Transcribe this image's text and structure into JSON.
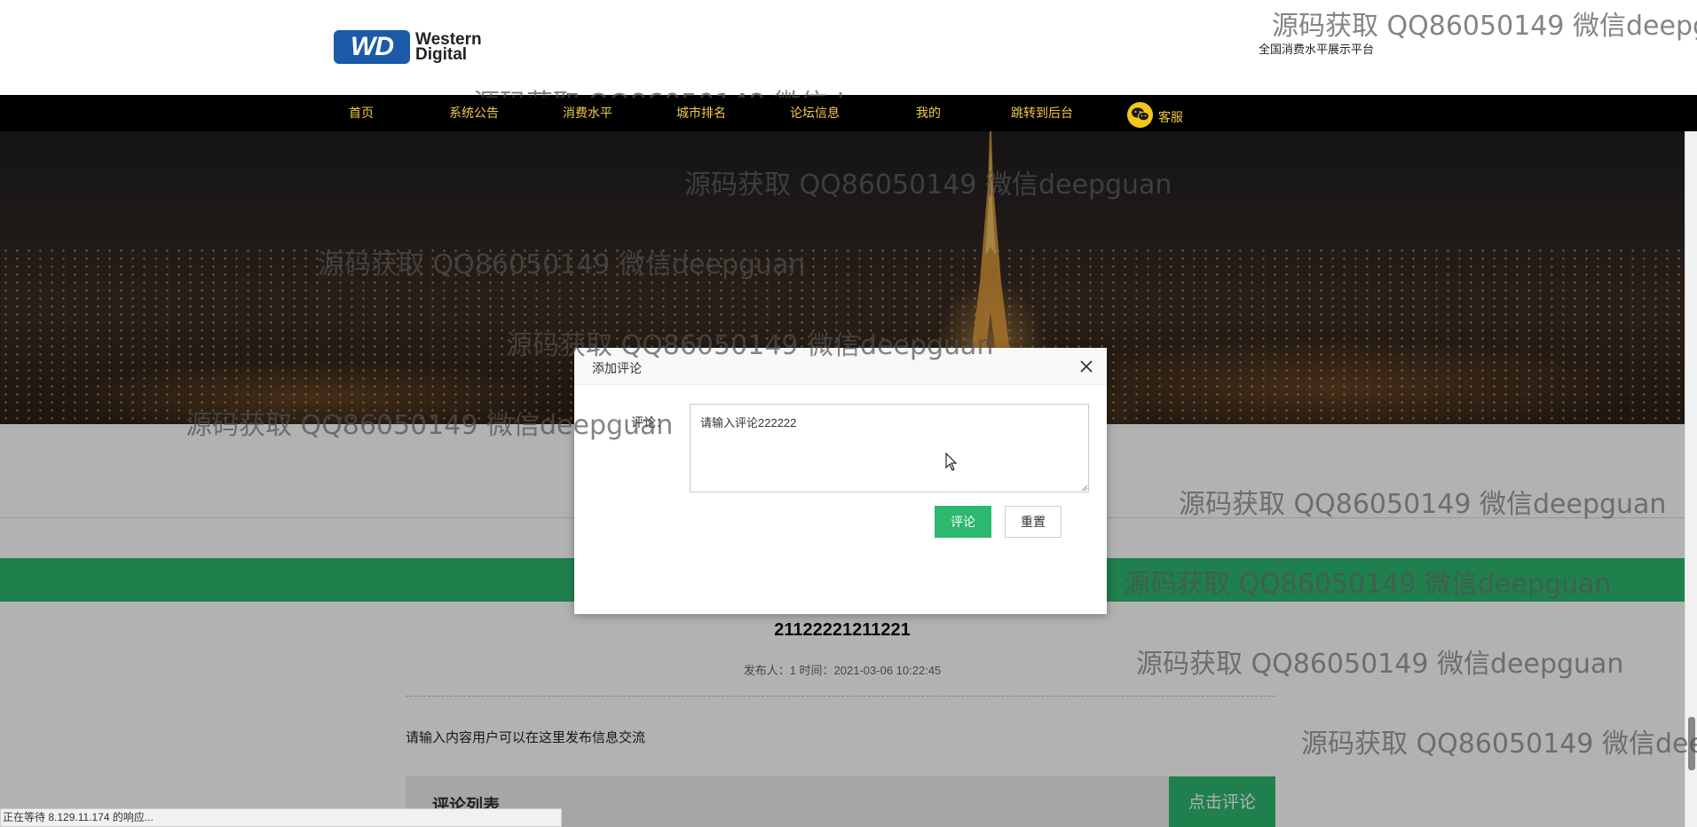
{
  "header": {
    "logo_badge": "WD",
    "logo_line1": "Western",
    "logo_line2": "Digital",
    "subtitle": "全国消费水平展示平台"
  },
  "nav": {
    "items": [
      {
        "label": "首页"
      },
      {
        "label": "系统公告"
      },
      {
        "label": "消费水平"
      },
      {
        "label": "城市排名"
      },
      {
        "label": "论坛信息"
      },
      {
        "label": "我的"
      },
      {
        "label": "跳转到后台"
      }
    ],
    "kefu_label": "客服"
  },
  "post": {
    "title": "21122221211221",
    "meta": "发布人：1 时间：2021-03-06 10:22:45",
    "content": "请输入内容用户可以在这里发布信息交流",
    "comment_list_title": "评论列表",
    "click_comment_label": "点击评论"
  },
  "modal": {
    "title": "添加评论",
    "field_label": "评论：",
    "textarea_value": "请输入评论222222",
    "submit_label": "评论",
    "reset_label": "重置"
  },
  "watermark": {
    "text": "源码获取 QQ86050149 微信deepguan",
    "text_partial_right": "源码获取 QQ86050149 微信deepg",
    "text_partial_right2": "源码获取 QQ86050149 微信dee"
  },
  "status_bar": {
    "text": "正在等待 8.129.11.174 的响应..."
  },
  "colors": {
    "accent_green": "#2db86f",
    "nav_text": "#f2c94c",
    "nav_bg": "#000000",
    "logo_blue": "#1a5aa8"
  }
}
